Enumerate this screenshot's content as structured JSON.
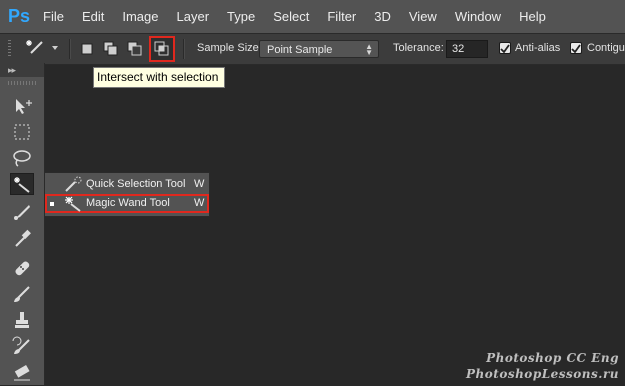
{
  "app": {
    "logo": "Ps"
  },
  "menu": [
    "File",
    "Edit",
    "Image",
    "Layer",
    "Type",
    "Select",
    "Filter",
    "3D",
    "View",
    "Window",
    "Help"
  ],
  "options_bar": {
    "sample_size_label": "Sample Size:",
    "sample_size_value": "Point Sample",
    "tolerance_label": "Tolerance:",
    "tolerance_value": "32",
    "anti_alias_label": "Anti-alias",
    "anti_alias_checked": true,
    "contiguous_label": "Contiguo",
    "contiguous_checked": true
  },
  "tooltip": {
    "text": "Intersect with selection"
  },
  "flyout": {
    "items": [
      {
        "label": "Quick Selection Tool",
        "shortcut": "W",
        "icon": "quick-selection-icon",
        "selected": false
      },
      {
        "label": "Magic Wand Tool",
        "shortcut": "W",
        "icon": "magic-wand-icon",
        "selected": true
      }
    ]
  },
  "toolbar": {
    "tools": [
      "move-tool",
      "marquee-tool",
      "lasso-tool",
      "magic-wand-tool",
      "crop-tool",
      "eyedropper-tool",
      "healing-brush-tool",
      "brush-tool",
      "clone-stamp-tool",
      "history-brush-tool",
      "eraser-tool"
    ]
  },
  "watermark": {
    "line1": "Photoshop  CC  Eng",
    "line2": "PhotoshopLessons.ru"
  },
  "colors": {
    "menubar": "#535353",
    "canvas": "#282828",
    "highlight": "#e0281e",
    "tooltip": "#ffffe1"
  }
}
